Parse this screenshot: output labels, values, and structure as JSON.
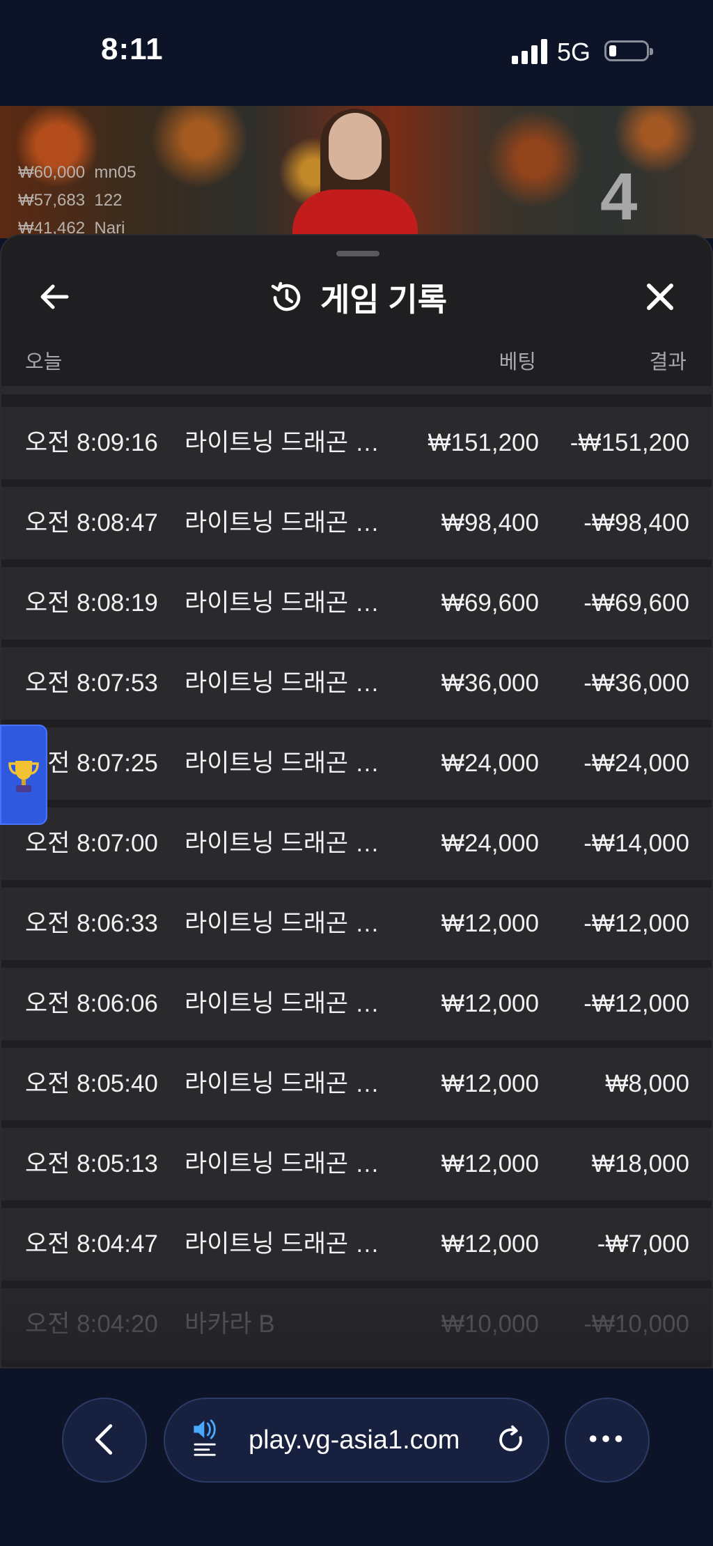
{
  "status_bar": {
    "time": "8:11",
    "network": "5G"
  },
  "game": {
    "players": [
      {
        "amount": "₩60,000",
        "name": "mn05"
      },
      {
        "amount": "₩57,683",
        "name": "122"
      },
      {
        "amount": "₩41,462",
        "name": "Nari"
      }
    ],
    "round_number": "4",
    "timer_color": "#1e9d4b"
  },
  "panel": {
    "title": "게임 기록",
    "title_icon": "history-icon",
    "columns": {
      "date": "오늘",
      "bet": "베팅",
      "result": "결과"
    },
    "rows": [
      {
        "time": "오전 8:09:16",
        "game": "라이트닝 드래곤 타...",
        "bet": "₩151,200",
        "result": "-₩151,200"
      },
      {
        "time": "오전 8:08:47",
        "game": "라이트닝 드래곤 타...",
        "bet": "₩98,400",
        "result": "-₩98,400"
      },
      {
        "time": "오전 8:08:19",
        "game": "라이트닝 드래곤 타...",
        "bet": "₩69,600",
        "result": "-₩69,600"
      },
      {
        "time": "오전 8:07:53",
        "game": "라이트닝 드래곤 타...",
        "bet": "₩36,000",
        "result": "-₩36,000"
      },
      {
        "time": "오전 8:07:25",
        "game": "라이트닝 드래곤 타...",
        "bet": "₩24,000",
        "result": "-₩24,000"
      },
      {
        "time": "오전 8:07:00",
        "game": "라이트닝 드래곤 타...",
        "bet": "₩24,000",
        "result": "-₩14,000"
      },
      {
        "time": "오전 8:06:33",
        "game": "라이트닝 드래곤 타...",
        "bet": "₩12,000",
        "result": "-₩12,000"
      },
      {
        "time": "오전 8:06:06",
        "game": "라이트닝 드래곤 타...",
        "bet": "₩12,000",
        "result": "-₩12,000"
      },
      {
        "time": "오전 8:05:40",
        "game": "라이트닝 드래곤 타...",
        "bet": "₩12,000",
        "result": "₩8,000"
      },
      {
        "time": "오전 8:05:13",
        "game": "라이트닝 드래곤 타...",
        "bet": "₩12,000",
        "result": "₩18,000"
      },
      {
        "time": "오전 8:04:47",
        "game": "라이트닝 드래곤 타...",
        "bet": "₩12,000",
        "result": "-₩7,000"
      },
      {
        "time": "오전 8:04:20",
        "game": "바카라 B",
        "bet": "₩10,000",
        "result": "-₩10,000"
      }
    ]
  },
  "browser": {
    "url": "play.vg-asia1.com"
  },
  "colors": {
    "background": "#0d1427",
    "panel": "#1f1f21",
    "row": "#2a2a2c",
    "accent": "#2f5ae0"
  }
}
